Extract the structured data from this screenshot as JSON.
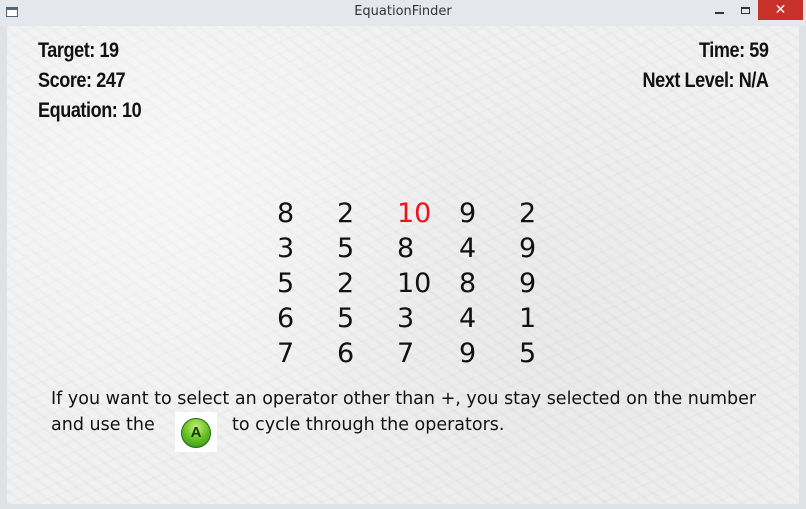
{
  "window": {
    "title": "EquationFinder",
    "controls": {
      "minimize": "minimize-icon",
      "maximize": "maximize-icon",
      "close": "✕"
    }
  },
  "hud": {
    "target": "Target: 19",
    "score": "Score: 247",
    "equation": "Equation: 10",
    "time": "Time:  59",
    "next_level": "Next Level: N/A"
  },
  "grid": {
    "rows": [
      [
        "8",
        "2",
        "10",
        "9",
        "2"
      ],
      [
        "3",
        "5",
        "8",
        "4",
        "9"
      ],
      [
        "5",
        "2",
        "10",
        "8",
        "9"
      ],
      [
        "6",
        "5",
        "3",
        "4",
        "1"
      ],
      [
        "7",
        "6",
        "7",
        "9",
        "5"
      ]
    ],
    "selected": {
      "row": 0,
      "col": 2
    },
    "selected_color": "#e8141d"
  },
  "instructions": {
    "line1": "If you want to select an operator other than +, you stay selected on the number",
    "line2_before": "and use the",
    "button_label": "A",
    "button_icon": "controller-a-button-icon",
    "line2_after": "to cycle through the operators."
  }
}
